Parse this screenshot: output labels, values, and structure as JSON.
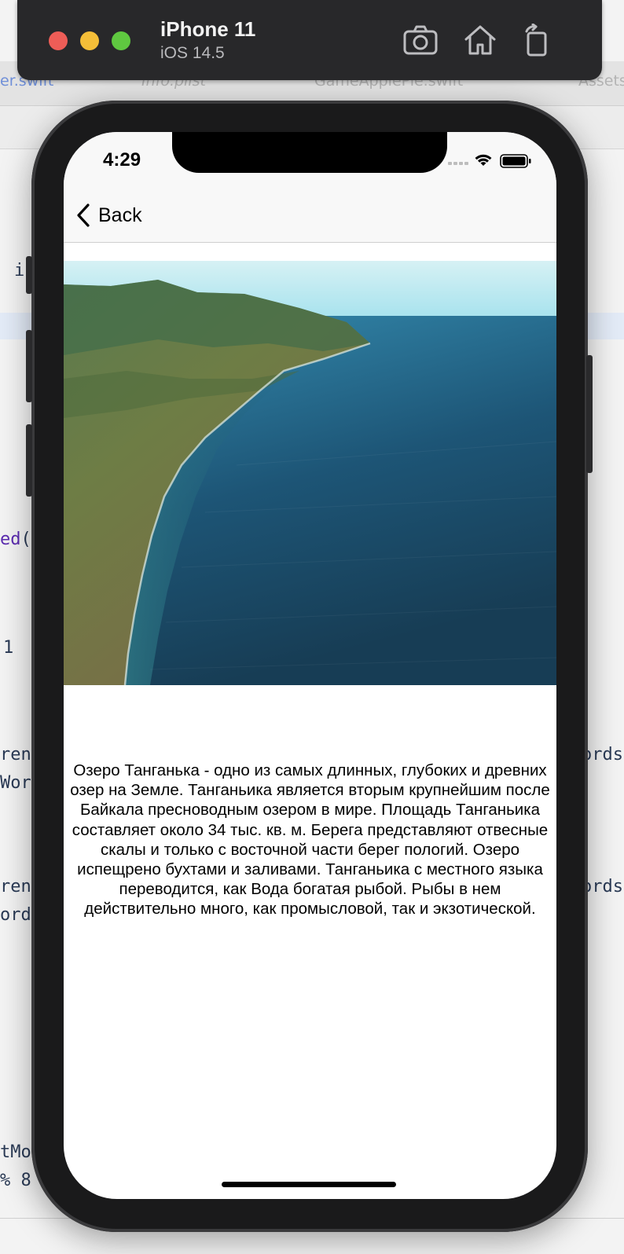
{
  "simulator": {
    "device_name": "iPhone 11",
    "os_version": "iOS 14.5",
    "toolbar_icons": [
      "screenshot-icon",
      "home-icon",
      "rotate-icon"
    ]
  },
  "xcode_background": {
    "tabs": [
      "er.swift",
      "Info.plist",
      "GameApplePie.swift",
      "Assets"
    ],
    "code_fragments": [
      "i",
      "ed(s",
      "1",
      "rent",
      "Word",
      "rent",
      "ord",
      "tMo",
      "% 8",
      "ords",
      "ords"
    ]
  },
  "status_bar": {
    "time": "4:29"
  },
  "nav": {
    "back_label": "Back"
  },
  "content": {
    "image_alt": "Lake Tanganyika coastline",
    "description": "Озеро Танганька - одно из самых длинных, глубоких и древних озер на Земле. Танганьика является вторым крупнейшим после Байкала пресноводным озером в мире. Площадь Танганьика составляет около 34 тыс. кв. м. Берега представляют отвесные скалы и только с восточной части берег пологий. Озеро испещрено бухтами и заливами. Танганьика с местного языка переводится, как Вода богатая рыбой. Рыбы в нем действительно много, как промысловой, так и экзотической."
  },
  "colors": {
    "traffic_red": "#ee5d57",
    "traffic_yellow": "#f4be38",
    "traffic_green": "#5fc840",
    "simulator_bar": "#28282a"
  }
}
